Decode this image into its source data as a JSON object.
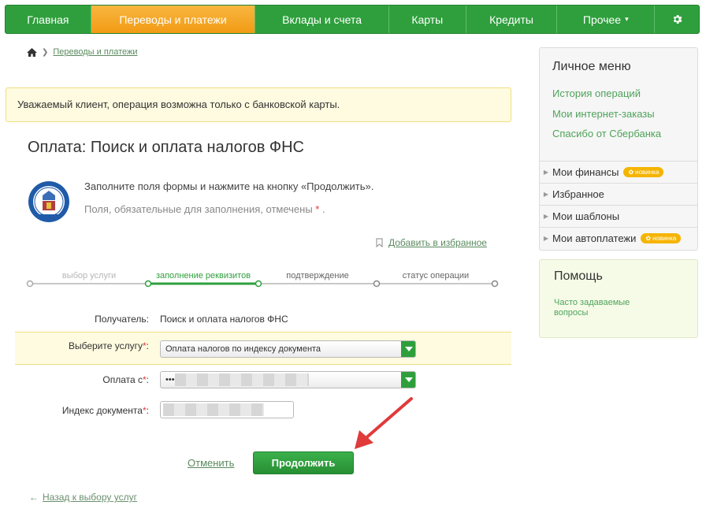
{
  "nav": {
    "items": [
      {
        "label": "Главная"
      },
      {
        "label": "Переводы и платежи"
      },
      {
        "label": "Вклады и счета"
      },
      {
        "label": "Карты"
      },
      {
        "label": "Кредиты"
      },
      {
        "label": "Прочее"
      }
    ],
    "settings_icon": "gear-icon"
  },
  "breadcrumb": {
    "home_icon": "home-icon",
    "link": "Переводы и платежи"
  },
  "notice": "Уважаемый клиент, операция возможна только с банковской карты.",
  "page_title": "Оплата: Поиск и оплата налогов ФНС",
  "instructions": {
    "line1": "Заполните поля формы и нажмите на кнопку «Продолжить».",
    "line2": "Поля, обязательные для заполнения, отмечены",
    "asterisk": "*",
    "period": "."
  },
  "favorite": {
    "label": "Добавить в избранное",
    "icon": "bookmark-icon"
  },
  "steps": [
    {
      "label": "выбор услуги",
      "state": "done"
    },
    {
      "label": "заполнение реквизитов",
      "state": "current"
    },
    {
      "label": "подтверждение",
      "state": "todo"
    },
    {
      "label": "статус операции",
      "state": "todo"
    }
  ],
  "form": {
    "recipient_label": "Получатель:",
    "recipient_value": "Поиск и оплата налогов ФНС",
    "service_label": "Выберите услугу",
    "service_value": "Оплата налогов по индексу документа",
    "payfrom_label": "Оплата с",
    "payfrom_value": "•••",
    "docindex_label": "Индекс документа",
    "required_mark": "*",
    "colon": ":"
  },
  "buttons": {
    "cancel": "Отменить",
    "continue": "Продолжить"
  },
  "back": {
    "arrow": "←",
    "label": "Назад к выбору услуг"
  },
  "sidebar": {
    "title": "Личное меню",
    "links": [
      "История операций",
      "Мои интернет-заказы",
      "Спасибо от Сбербанка"
    ],
    "items": [
      {
        "label": "Мои финансы",
        "badge": "новинка"
      },
      {
        "label": "Избранное",
        "badge": ""
      },
      {
        "label": "Мои шаблоны",
        "badge": ""
      },
      {
        "label": "Мои автоплатежи",
        "badge": "новинка"
      }
    ],
    "help_title": "Помощь",
    "help_link": "Часто задаваемые вопросы"
  },
  "colors": {
    "brand_green": "#2e9f3c",
    "active_orange": "#f29b14",
    "link_green": "#4fa35a"
  }
}
